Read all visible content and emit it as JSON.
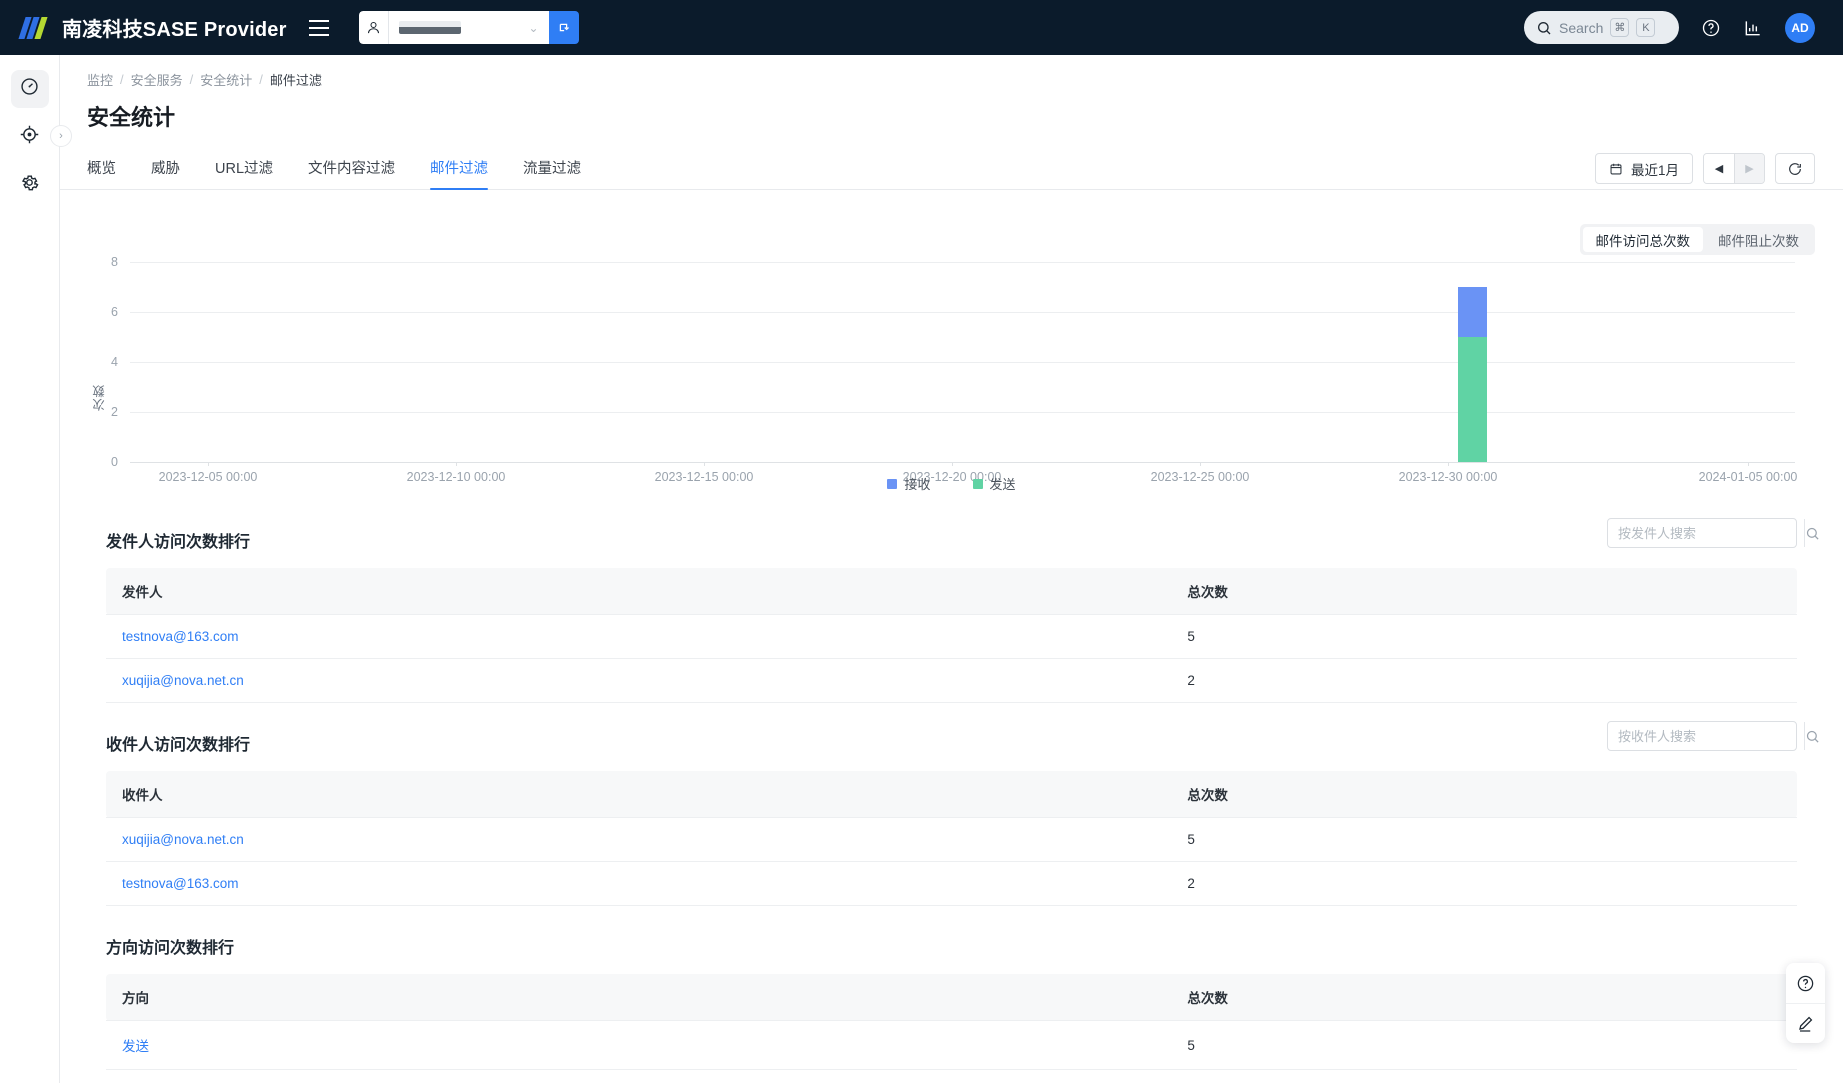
{
  "header": {
    "brand": "南凌科技SASE Provider",
    "menu_icon": "hamburger-icon",
    "tenant": {
      "value": "",
      "caret": "⌄",
      "switch_icon": "switch-tenant-icon"
    },
    "search": {
      "label": "Search",
      "key_cmd": "⌘",
      "key_letter": "K"
    },
    "avatar": "AD"
  },
  "sidebar": {
    "items": [
      {
        "name": "dashboard",
        "icon": "gauge-icon",
        "active": true
      },
      {
        "name": "monitor",
        "icon": "target-icon",
        "active": false
      },
      {
        "name": "settings",
        "icon": "gear-icon",
        "active": false
      }
    ],
    "expand": "›"
  },
  "breadcrumb": {
    "items": [
      "监控",
      "安全服务",
      "安全统计"
    ],
    "current": "邮件过滤",
    "separator": "/"
  },
  "page": {
    "title": "安全统计"
  },
  "tabs": [
    {
      "label": "概览",
      "active": false
    },
    {
      "label": "威胁",
      "active": false
    },
    {
      "label": "URL过滤",
      "active": false
    },
    {
      "label": "文件内容过滤",
      "active": false
    },
    {
      "label": "邮件过滤",
      "active": true
    },
    {
      "label": "流量过滤",
      "active": false
    }
  ],
  "daterange": {
    "label": "最近1月",
    "prev": "◀",
    "next": "▶",
    "refresh": "refresh-icon"
  },
  "metric_toggle": [
    {
      "label": "邮件访问总次数",
      "active": true
    },
    {
      "label": "邮件阻止次数",
      "active": false
    }
  ],
  "chart_data": {
    "type": "bar",
    "stacked": true,
    "title": "",
    "xlabel": "",
    "ylabel": "次数",
    "ylim": [
      0,
      8
    ],
    "yticks": [
      0,
      2,
      4,
      6,
      8
    ],
    "grid": true,
    "legend_position": "bottom",
    "xticks": [
      "2023-12-05 00:00",
      "2023-12-10 00:00",
      "2023-12-15 00:00",
      "2023-12-20 00:00",
      "2023-12-25 00:00",
      "2023-12-30 00:00",
      "2024-01-05 00:00"
    ],
    "x_range": [
      "2023-12-03 00:00",
      "2024-01-06 00:00"
    ],
    "series": [
      {
        "name": "接收",
        "color": "#6a93f5",
        "points": [
          {
            "x": "2023-12-28 12:00",
            "y": 2
          }
        ]
      },
      {
        "name": "发送",
        "color": "#60d3a4",
        "points": [
          {
            "x": "2023-12-28 12:00",
            "y": 5
          }
        ]
      }
    ],
    "bar_total": 7
  },
  "panels": [
    {
      "title": "发件人访问次数排行",
      "search_placeholder": "按发件人搜索",
      "search_value": "",
      "columns": [
        "发件人",
        "总次数"
      ],
      "rows": [
        {
          "name": "testnova@163.com",
          "count": "5"
        },
        {
          "name": "xuqijia@nova.net.cn",
          "count": "2"
        }
      ]
    },
    {
      "title": "收件人访问次数排行",
      "search_placeholder": "按收件人搜索",
      "search_value": "",
      "columns": [
        "收件人",
        "总次数"
      ],
      "rows": [
        {
          "name": "xuqijia@nova.net.cn",
          "count": "5"
        },
        {
          "name": "testnova@163.com",
          "count": "2"
        }
      ]
    },
    {
      "title": "方向访问次数排行",
      "search_placeholder": "",
      "search_value": "",
      "columns": [
        "方向",
        "总次数"
      ],
      "rows": [
        {
          "name": "发送",
          "count": "5"
        }
      ]
    }
  ],
  "dock": [
    {
      "name": "help-icon"
    },
    {
      "name": "edit-icon"
    }
  ],
  "colors": {
    "accent": "#2f7ef5",
    "header_bg": "#0b1b2b",
    "series_recv": "#6a93f5",
    "series_send": "#60d3a4"
  }
}
